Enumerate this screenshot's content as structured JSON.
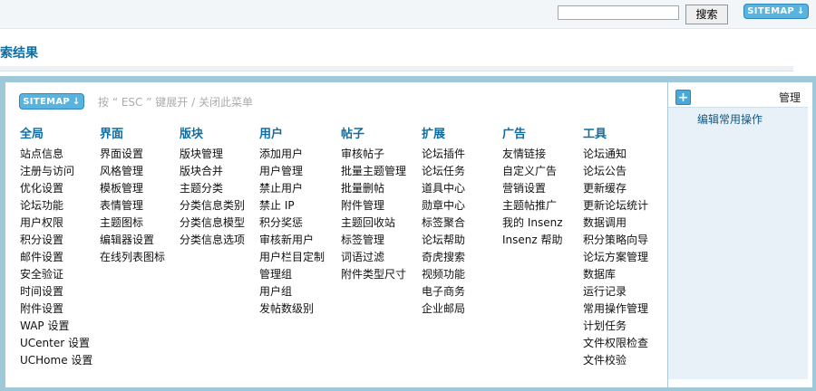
{
  "header": {
    "search_placeholder": "",
    "search_button": "搜索",
    "sitemap_label": "SITEMAP",
    "sitemap_arrow": "↓"
  },
  "page": {
    "title": "索结果"
  },
  "sitemap_panel": {
    "button_label": "SITEMAP",
    "button_arrow": "↓",
    "hint": "按 “ ESC ” 键展开 / 关闭此菜单",
    "columns": [
      {
        "heading": "全局",
        "items": [
          "站点信息",
          "注册与访问",
          "优化设置",
          "论坛功能",
          "用户权限",
          "积分设置",
          "邮件设置",
          "安全验证",
          "时间设置",
          "附件设置",
          "WAP 设置",
          "UCenter 设置",
          "UCHome 设置"
        ]
      },
      {
        "heading": "界面",
        "items": [
          "界面设置",
          "风格管理",
          "模板管理",
          "表情管理",
          "主题图标",
          "编辑器设置",
          "在线列表图标"
        ]
      },
      {
        "heading": "版块",
        "items": [
          "版块管理",
          "版块合并",
          "主题分类",
          "分类信息类别",
          "分类信息模型",
          "分类信息选项"
        ]
      },
      {
        "heading": "用户",
        "items": [
          "添加用户",
          "用户管理",
          "禁止用户",
          "禁止 IP",
          "积分奖惩",
          "审核新用户",
          "用户栏目定制",
          "管理组",
          "用户组",
          "发帖数级别"
        ]
      },
      {
        "heading": "帖子",
        "items": [
          "审核帖子",
          "批量主题管理",
          "批量删帖",
          "附件管理",
          "主题回收站",
          "标签管理",
          "词语过滤",
          "附件类型尺寸"
        ]
      },
      {
        "heading": "扩展",
        "items": [
          "论坛插件",
          "论坛任务",
          "道具中心",
          "勋章中心",
          "标签聚合",
          "论坛帮助",
          "奇虎搜索",
          "视频功能",
          "电子商务",
          "企业邮局"
        ]
      },
      {
        "heading": "广告",
        "items": [
          "友情链接",
          "自定义广告",
          "营销设置",
          "主题帖推广",
          "我的 Insenz",
          "Insenz 帮助"
        ]
      },
      {
        "heading": "工具",
        "items": [
          "论坛通知",
          "论坛公告",
          "更新缓存",
          "更新论坛统计",
          "数据调用",
          "积分策略向导",
          "论坛方案管理",
          "数据库",
          "运行记录",
          "常用操作管理",
          "计划任务",
          "文件权限检查",
          "文件校验"
        ]
      }
    ],
    "side": {
      "plus": "+",
      "title": "管理",
      "link": "编辑常用操作"
    }
  }
}
